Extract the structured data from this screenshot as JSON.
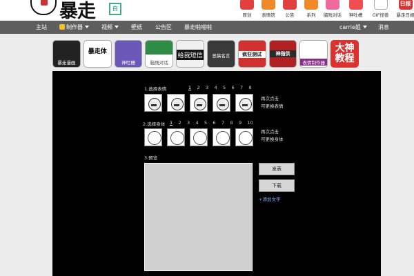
{
  "logo": {
    "text": "暴走",
    "badge": "白"
  },
  "top_nav": [
    {
      "label": "原创",
      "icon": "original-icon",
      "color": "#e04040"
    },
    {
      "label": "表情馆",
      "icon": "emoji-hall-icon",
      "color": "#f08a28"
    },
    {
      "label": "公告",
      "icon": "announcement-icon",
      "color": "#e04040"
    },
    {
      "label": "系列",
      "icon": "series-icon",
      "color": "#f08a28"
    },
    {
      "label": "脑残对话",
      "icon": "dialogue-icon",
      "color": "#f06aa0"
    },
    {
      "label": "神吐槽",
      "icon": "roast-icon",
      "color": "#f04e4e"
    },
    {
      "label": "GIF怪兽",
      "icon": "gif-monster-icon",
      "color": "#ffffff"
    },
    {
      "label": "暴走日报",
      "icon": "daily-news-icon",
      "color": "#d9322f",
      "icon_text": "日报"
    }
  ],
  "main_nav": {
    "home": "主站",
    "maker": "制作器",
    "video": "视频",
    "wallpaper": "壁纸",
    "announcements": "公告区",
    "hot": "暴走啪啪啪",
    "user": "carrie姐",
    "messages": "消息"
  },
  "tools": [
    {
      "caption": "暴走漫画"
    },
    {
      "caption": "暴走体"
    },
    {
      "caption": "神吐槽"
    },
    {
      "caption": "脑残对话"
    },
    {
      "caption": "给我短信"
    },
    {
      "caption": "恶搞名言"
    },
    {
      "caption": "疯狂测试"
    },
    {
      "caption": "神指供"
    },
    {
      "caption": "表情制作器"
    },
    {
      "caption": "大神教程"
    }
  ],
  "editor": {
    "step1_label": "1.选择表情",
    "step1_numbers": [
      "1",
      "2",
      "3",
      "4",
      "5",
      "6",
      "7",
      "8"
    ],
    "step1_hint_line1": "再次点击",
    "step1_hint_line2": "可更换表情",
    "step2_label": "2.选择身体",
    "step2_numbers": [
      "1",
      "2",
      "3",
      "4",
      "5",
      "6",
      "7",
      "8",
      "9",
      "10"
    ],
    "step2_hint_line1": "再次点击",
    "step2_hint_line2": "可更换身体",
    "step3_label": "3.预览",
    "publish_button": "发表",
    "download_button": "下载",
    "add_text_link": "+添加文字"
  }
}
